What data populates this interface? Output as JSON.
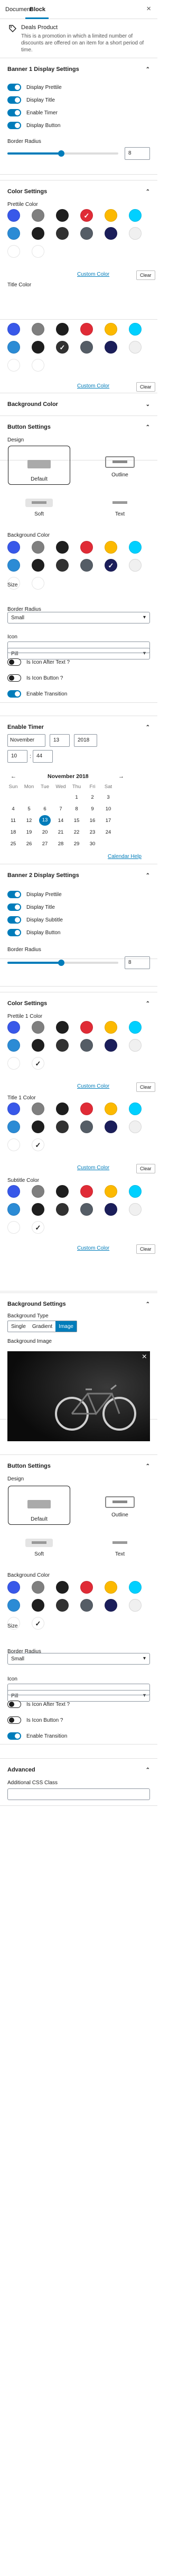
{
  "tabs": {
    "document": "Document",
    "block": "Block",
    "close": "×"
  },
  "block": {
    "name": "Deals Product",
    "description": "This is a promotion in which a limited number of discounts are offered on an item for a short period of time."
  },
  "banner1": {
    "title": "Banner 1 Display Settings",
    "toggles": [
      "Display Prettile",
      "Display Title",
      "Enable Timer",
      "Display Button"
    ],
    "border_radius_label": "Border Radius",
    "border_radius": "8"
  },
  "color1": {
    "title": "Color Settings",
    "prettile_label": "Prettile Color",
    "title_label": "Title Color",
    "custom": "Custom Color",
    "clear": "Clear"
  },
  "background1": {
    "title": "Background Color"
  },
  "button1": {
    "title": "Button Settings",
    "design_label": "Design",
    "styles": [
      "Default",
      "Outline",
      "Soft",
      "Text"
    ],
    "bg_label": "Background Color",
    "size_label": "Size",
    "size": "Small",
    "radius_label": "Border Radius",
    "radius": "Pill",
    "icon_label": "Icon",
    "after_text": "Is Icon After Text ?",
    "icon_button": "Is Icon Button ?",
    "transition": "Enable Transition"
  },
  "timer": {
    "title": "Enable Timer",
    "month": "November",
    "day": "13",
    "year": "2018",
    "hour": "10",
    "minute": "44",
    "cal_title": "November 2018",
    "weekdays": [
      "Sun",
      "Mon",
      "Tue",
      "Wed",
      "Thu",
      "Fri",
      "Sat"
    ],
    "weeks": [
      [
        "",
        "",
        "",
        "",
        "1",
        "2",
        "3"
      ],
      [
        "4",
        "5",
        "6",
        "7",
        "8",
        "9",
        "10"
      ],
      [
        "11",
        "12",
        "13",
        "14",
        "15",
        "16",
        "17"
      ],
      [
        "18",
        "19",
        "20",
        "21",
        "22",
        "23",
        "24"
      ],
      [
        "25",
        "26",
        "27",
        "28",
        "29",
        "30",
        ""
      ]
    ],
    "help": "Calendar Help"
  },
  "banner2": {
    "title": "Banner 2 Display Settings",
    "toggles": [
      "Display Prettile",
      "Display Title",
      "Display Subtitle",
      "Display Button"
    ],
    "border_radius_label": "Border Radius",
    "border_radius": "8"
  },
  "color2": {
    "title": "Color Settings",
    "prettile_label": "Prettile 1 Color",
    "title_label": "Title 1 Color",
    "subtitle_label": "Subtitle Color",
    "custom": "Custom Color",
    "clear": "Clear"
  },
  "background2": {
    "title": "Background Settings",
    "type_label": "Background Type",
    "types": [
      "Single",
      "Gradient",
      "Image"
    ],
    "image_label": "Background Image",
    "image_close": "×"
  },
  "button2": {
    "title": "Button Settings",
    "design_label": "Design",
    "styles": [
      "Default",
      "Outline",
      "Soft",
      "Text"
    ],
    "bg_label": "Background Color",
    "size_label": "Size",
    "size": "Small",
    "radius_label": "Border Radius",
    "radius": "Pill",
    "icon_label": "Icon",
    "after_text": "Is Icon After Text ?",
    "icon_button": "Is Icon Button ?",
    "transition": "Enable Transition"
  },
  "advanced": {
    "title": "Advanced",
    "css_label": "Additional CSS Class"
  },
  "colors": {
    "accent": "#007cba",
    "palette": [
      "#3858e9",
      "#7f7f7f",
      "#1e1e1e",
      "#e02b36",
      "#fcb900",
      "#00d0ff",
      "#2b8bd5",
      "#1e1e1e",
      "#313131",
      "#555d66",
      "#1b1e5a",
      "#f0f0f0",
      "#ffffff",
      "#ffffff"
    ]
  }
}
